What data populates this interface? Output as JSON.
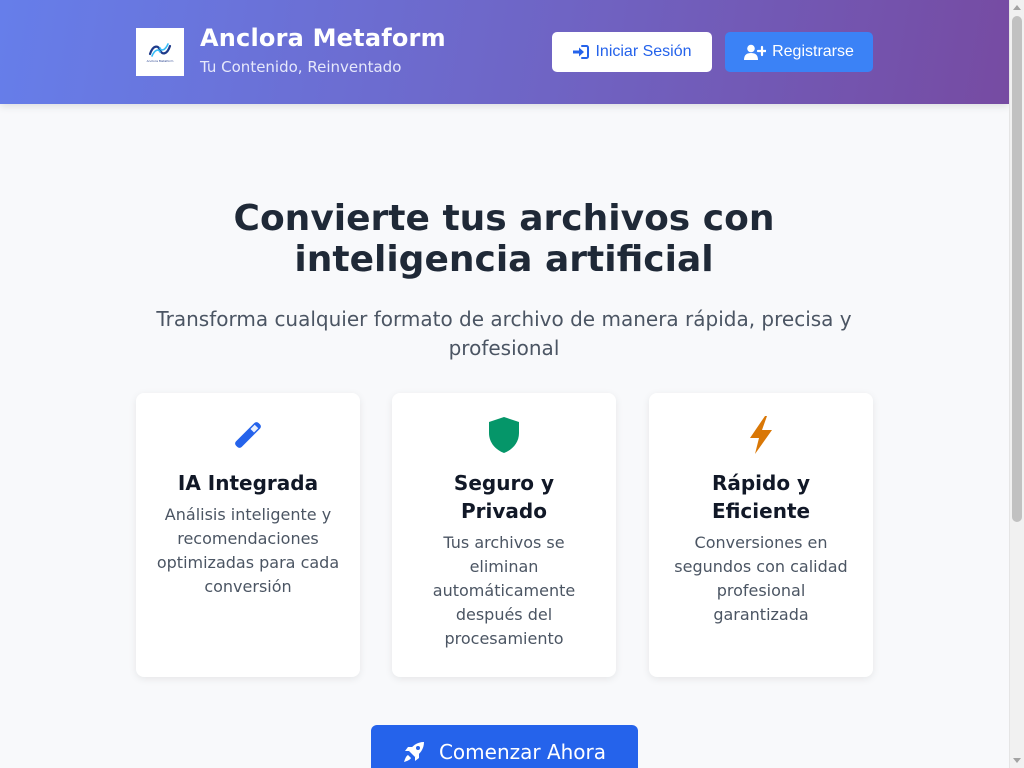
{
  "header": {
    "logo_text": "Anclora Metaform",
    "brand_title": "Anclora Metaform",
    "brand_subtitle": "Tu Contenido, Reinventado",
    "login_label": "Iniciar Sesión",
    "register_label": "Registrarse",
    "login_icon": "sign-in-icon",
    "register_icon": "user-plus-icon"
  },
  "hero": {
    "title_line1": "Convierte tus archivos con",
    "title_line2": "inteligencia artificial",
    "subtitle": "Transforma cualquier formato de archivo de manera rápida, precisa y profesional"
  },
  "features": [
    {
      "icon": "magic-wand-icon",
      "icon_color": "#2563eb",
      "title": "IA Integrada",
      "description": "Análisis inteligente y recomendaciones optimizadas para cada conversión"
    },
    {
      "icon": "shield-icon",
      "icon_color": "#059669",
      "title": "Seguro y Privado",
      "description": "Tus archivos se eliminan automáticamente después del procesamiento"
    },
    {
      "icon": "lightning-icon",
      "icon_color": "#d97706",
      "title": "Rápido y Eficiente",
      "description": "Conversiones en segundos con calidad profesional garantizada"
    }
  ],
  "cta": {
    "label": "Comenzar Ahora",
    "icon": "rocket-icon"
  },
  "colors": {
    "header_gradient_start": "#667eea",
    "header_gradient_end": "#764ba2",
    "primary": "#2563eb",
    "register_button": "#3b82f6",
    "page_background": "#f8f9fb"
  }
}
